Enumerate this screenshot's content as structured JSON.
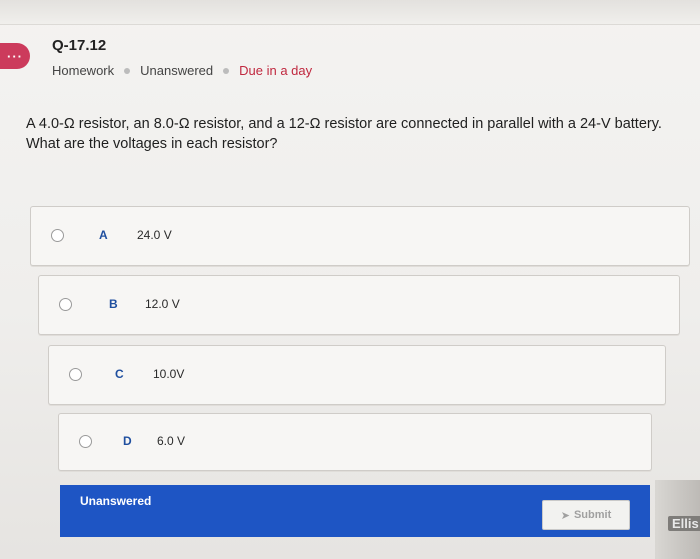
{
  "header": {
    "menu_icon": "···",
    "question_id": "Q-17.12",
    "meta": {
      "type": "Homework",
      "status": "Unanswered",
      "due": "Due in a day"
    }
  },
  "question": {
    "line1": "A 4.0-Ω resistor, an 8.0-Ω resistor, and a 12-Ω resistor are connected in parallel with a 24-V battery.",
    "line2": "What are the voltages in each resistor?"
  },
  "options": [
    {
      "letter": "A",
      "value": "24.0 V"
    },
    {
      "letter": "B",
      "value": "12.0 V"
    },
    {
      "letter": "C",
      "value": "10.0V"
    },
    {
      "letter": "D",
      "value": "6.0 V"
    }
  ],
  "footer": {
    "status": "Unanswered",
    "submit_label": "Submit"
  },
  "user": {
    "name": "Ellis"
  },
  "colors": {
    "accent": "#1e55c4",
    "due": "#c0283f",
    "menu": "#cc3b5c"
  }
}
